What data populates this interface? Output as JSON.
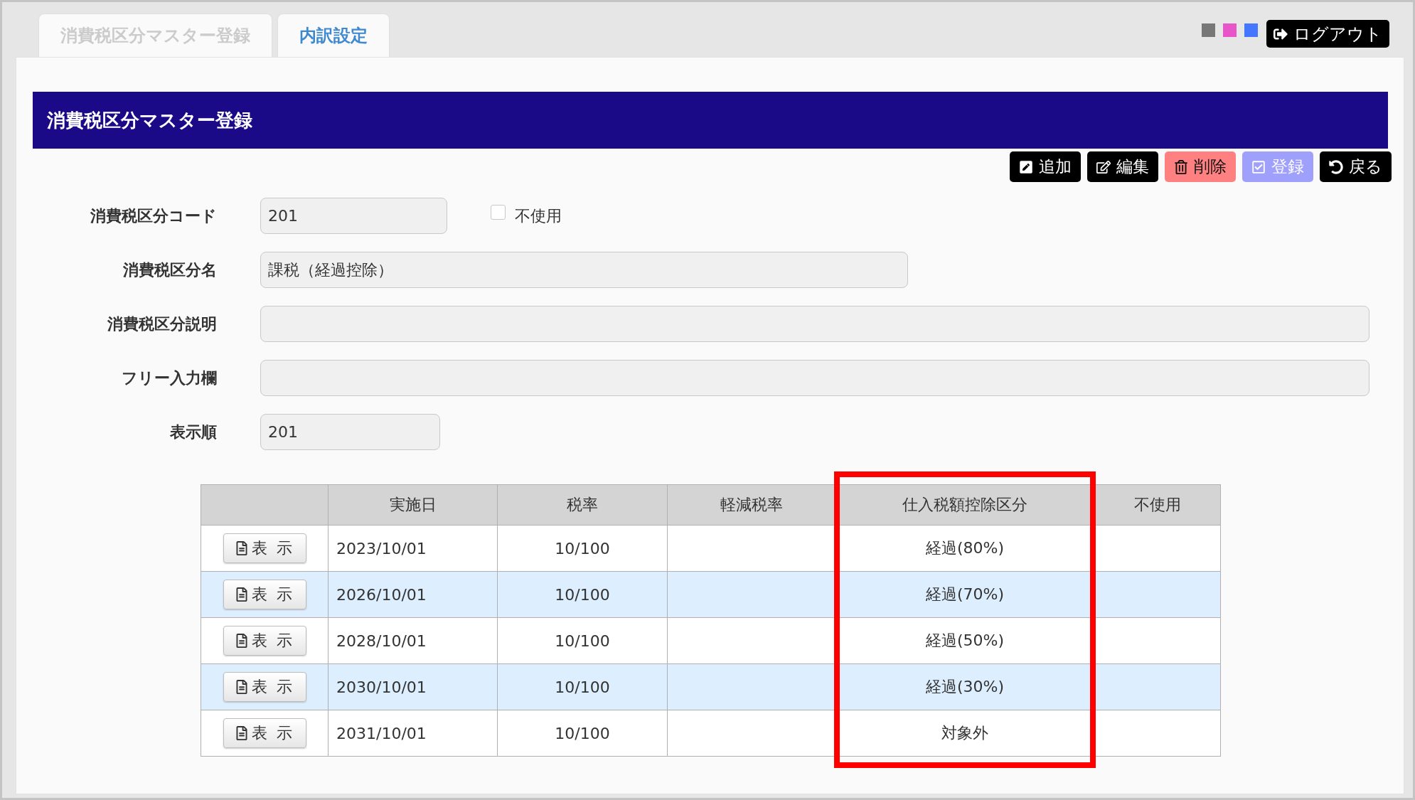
{
  "tabs": [
    {
      "label": "消費税区分マスター登録",
      "selected": true
    },
    {
      "label": "内訳設定",
      "selected": false
    }
  ],
  "theme_colors": [
    {
      "color": "#777777"
    },
    {
      "color": "#e855c8"
    },
    {
      "color": "#4477ff"
    }
  ],
  "logout_button": {
    "label": "ログアウト"
  },
  "page_title": "消費税区分マスター登録",
  "toolbar": [
    {
      "kind": "add",
      "label": "追加",
      "disabled": false
    },
    {
      "kind": "edit",
      "label": "編集",
      "disabled": false
    },
    {
      "kind": "delete",
      "label": "削除",
      "disabled": false
    },
    {
      "kind": "register",
      "label": "登録",
      "disabled": true
    },
    {
      "kind": "back",
      "label": "戻る",
      "disabled": false
    }
  ],
  "form": {
    "fields": [
      {
        "label": "消費税区分コード",
        "value": "201",
        "checkbox": {
          "label": "不使用",
          "checked": false
        }
      },
      {
        "label": "消費税区分名",
        "value": "課税（経過控除）"
      },
      {
        "label": "消費税区分説明"
      },
      {
        "label": "フリー入力欄"
      },
      {
        "label": "表示順",
        "value": "201"
      }
    ]
  },
  "table": {
    "columns": [
      {
        "label": "実施日",
        "highlighted": false
      },
      {
        "label": "税率",
        "highlighted": false
      },
      {
        "label": "軽減税率",
        "highlighted": false
      },
      {
        "label": "仕入税額控除区分",
        "highlighted": true
      },
      {
        "label": "不使用",
        "highlighted": false
      }
    ],
    "rows": [
      {
        "button": "表 示",
        "effective_date": "2023/10/01",
        "tax_rate": "10/100",
        "deduction_category": "経過(80%)"
      },
      {
        "button": "表 示",
        "effective_date": "2026/10/01",
        "tax_rate": "10/100",
        "deduction_category": "経過(70%)"
      },
      {
        "button": "表 示",
        "effective_date": "2028/10/01",
        "tax_rate": "10/100",
        "deduction_category": "経過(50%)"
      },
      {
        "button": "表 示",
        "effective_date": "2030/10/01",
        "tax_rate": "10/100",
        "deduction_category": "経過(30%)"
      },
      {
        "button": "表 示",
        "effective_date": "2031/10/01",
        "tax_rate": "10/100",
        "deduction_category": "対象外"
      }
    ]
  }
}
